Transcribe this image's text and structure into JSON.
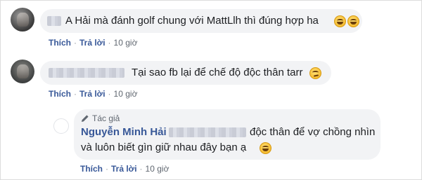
{
  "comments": [
    {
      "text": "A Hải mà đánh golf chung với MattLlh thì đúng hợp ha",
      "actions": {
        "like": "Thích",
        "reply": "Trả lời",
        "time": "10 giờ"
      }
    },
    {
      "text": "Tại sao fb lại để chế độ độc thân tarr",
      "actions": {
        "like": "Thích",
        "reply": "Trả lời",
        "time": "10 giờ"
      }
    }
  ],
  "reply": {
    "author_badge": "Tác giả",
    "author_name": "Nguyễn Minh Hải",
    "line1": "độc thân để vợ chồng nhìn",
    "line2": "và luôn biết gìn giữ nhau đây bạn ạ",
    "actions": {
      "like": "Thích",
      "reply": "Trả lời",
      "time": "10 giờ"
    }
  },
  "icons": [
    "grinning-face-emoji",
    "smirking-face-emoji",
    "pencil-icon"
  ],
  "colors": {
    "link": "#385898",
    "bubble": "#f2f3f5",
    "text": "#1c1e21",
    "meta": "#606770"
  }
}
